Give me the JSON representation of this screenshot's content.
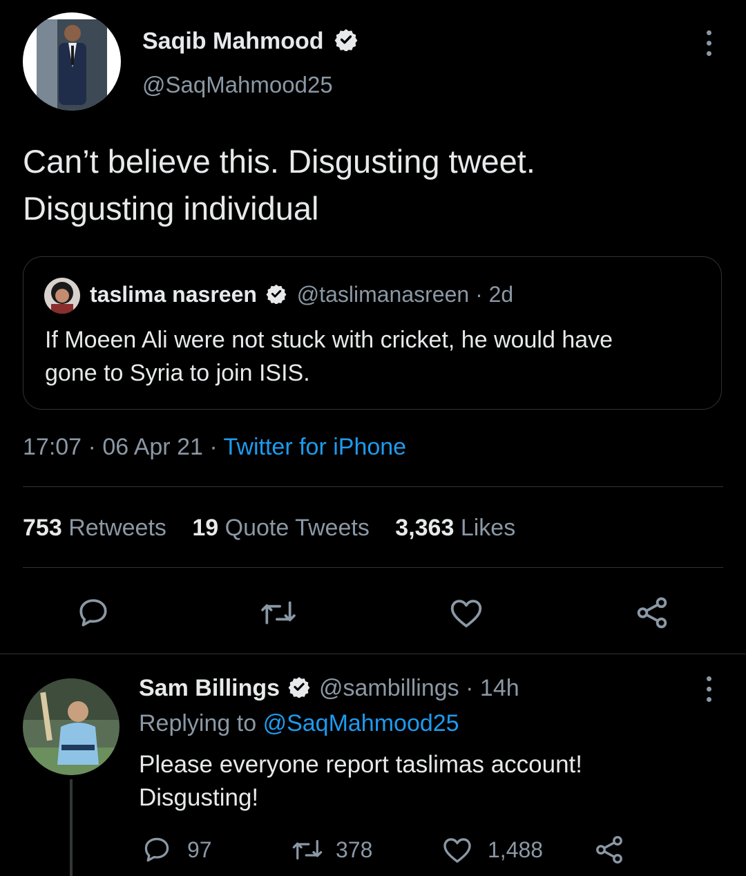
{
  "tweet": {
    "author_name": "Saqib Mahmood",
    "author_handle": "@SaqMahmood25",
    "text_line1": "Can’t believe this. Disgusting tweet.",
    "text_line2": "Disgusting individual",
    "time": "17:07",
    "date": "06 Apr 21",
    "source": "Twitter for iPhone",
    "stats": {
      "retweets_count": "753",
      "retweets_label": "Retweets",
      "quotes_count": "19",
      "quotes_label": "Quote Tweets",
      "likes_count": "3,363",
      "likes_label": "Likes"
    }
  },
  "quoted_tweet": {
    "author_name": "taslima nasreen",
    "author_handle": "@taslimanasreen",
    "age": "2d",
    "text_line1": "If Moeen Ali were not stuck with cricket,  he would have",
    "text_line2": "gone to Syria to join ISIS."
  },
  "reply": {
    "author_name": "Sam Billings",
    "author_handle": "@sambillings",
    "age": "14h",
    "replying_label": "Replying to",
    "replying_handle": "@SaqMahmood25",
    "text_line1": "Please everyone report taslimas account!",
    "text_line2": "Disgusting!",
    "reply_count": "97",
    "retweet_count": "378",
    "like_count": "1,488"
  },
  "separator": "·",
  "icons": {
    "verified": "verified-badge-icon",
    "more": "more-vertical-icon",
    "reply": "reply-bubble-icon",
    "retweet": "retweet-icon",
    "like": "heart-icon",
    "share": "share-icon"
  },
  "colors": {
    "background": "#000000",
    "text": "#e7e9ea",
    "secondary": "#8b98a5",
    "accent": "#1d9bf0",
    "border": "#2f3336"
  }
}
